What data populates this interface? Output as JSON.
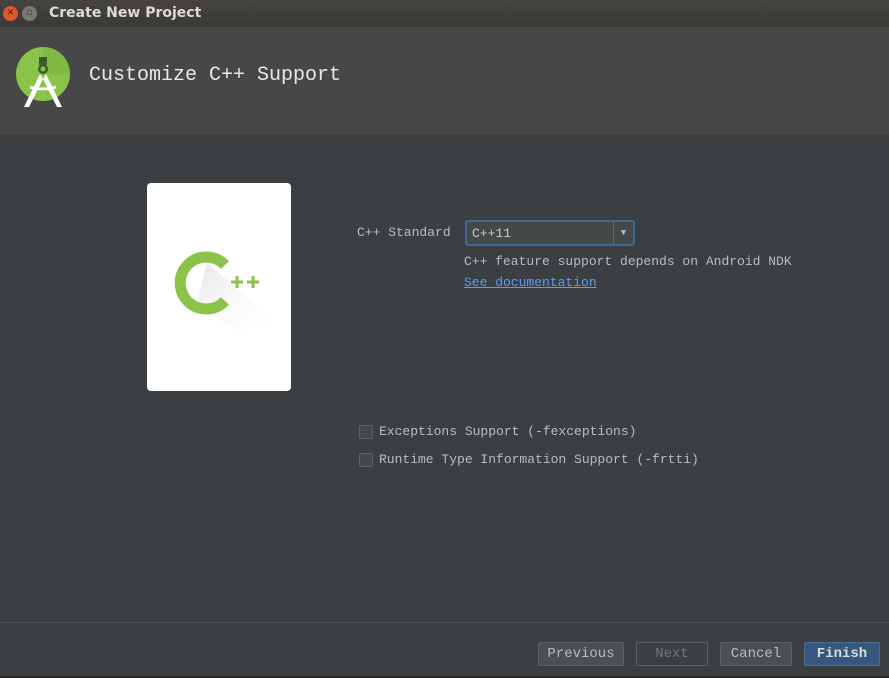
{
  "window": {
    "title": "Create New Project"
  },
  "header": {
    "title": "Customize C++ Support",
    "logo": "android-studio-logo"
  },
  "form": {
    "cpp_standard_label": "C++ Standard",
    "cpp_standard_value": "C++11",
    "hint": "C++ feature support depends on Android NDK",
    "doc_link": "See documentation",
    "exceptions_label": "Exceptions Support (-fexceptions)",
    "exceptions_checked": false,
    "rtti_label": "Runtime Type Information Support (-frtti)",
    "rtti_checked": false
  },
  "footer": {
    "previous": "Previous",
    "next": "Next",
    "cancel": "Cancel",
    "finish": "Finish"
  },
  "colors": {
    "accent": "#365880",
    "link": "#589df6",
    "logo_green": "#8bc34a"
  }
}
